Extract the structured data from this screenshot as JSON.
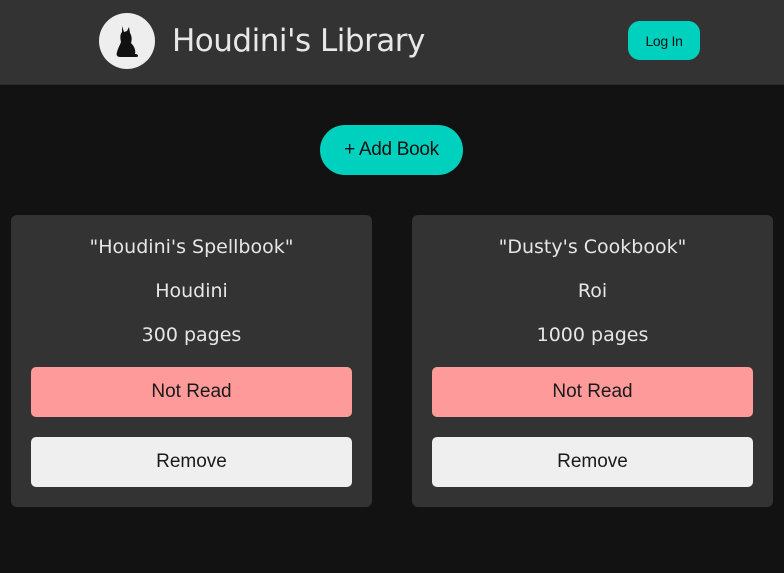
{
  "header": {
    "title": "Houdini's Library",
    "login_label": "Log In",
    "logo_icon": "cat-silhouette-icon"
  },
  "actions": {
    "add_book_label": "+ Add Book"
  },
  "colors": {
    "accent": "#00d1bf",
    "not_read": "#ff9a9a",
    "card_bg": "#333333",
    "page_bg": "#121212"
  },
  "books": [
    {
      "title": "\"Houdini's Spellbook\"",
      "author": "Houdini",
      "pages": "300 pages",
      "status_label": "Not Read",
      "remove_label": "Remove"
    },
    {
      "title": "\"Dusty's Cookbook\"",
      "author": "Roi",
      "pages": "1000 pages",
      "status_label": "Not Read",
      "remove_label": "Remove"
    }
  ]
}
